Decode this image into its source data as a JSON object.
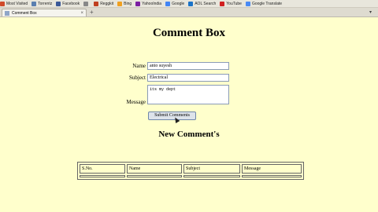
{
  "bookmarks": [
    {
      "label": "Most Visited",
      "color": "#d04a2a"
    },
    {
      "label": "Torrentz",
      "color": "#5a7fb0"
    },
    {
      "label": "Facebook",
      "color": "#3b5998"
    },
    {
      "label": "",
      "color": "#888888"
    },
    {
      "label": "Reggkit",
      "color": "#c04020"
    },
    {
      "label": "Bing",
      "color": "#f0a020"
    },
    {
      "label": "YahooIndia",
      "color": "#7b1fa2"
    },
    {
      "label": "Google",
      "color": "#4285f4"
    },
    {
      "label": "AOL Search",
      "color": "#1a73c8"
    },
    {
      "label": "YouTube",
      "color": "#d02020"
    },
    {
      "label": "Google Translate",
      "color": "#4a8af4"
    }
  ],
  "tab": {
    "title": "Comment Box",
    "close": "×",
    "new_tab": "+",
    "scroll": "▾"
  },
  "page": {
    "title": "Comment Box",
    "name_label": "Name",
    "name_value": "anto suyesh",
    "subject_label": "Subject",
    "subject_value": "Electrical",
    "message_label": "Message",
    "message_value": "its my dept",
    "submit_label": "Submit Comments",
    "section_title": "New Comment's"
  },
  "table": {
    "headers": [
      "S.No.",
      "Name",
      "Subject",
      "Message"
    ]
  }
}
